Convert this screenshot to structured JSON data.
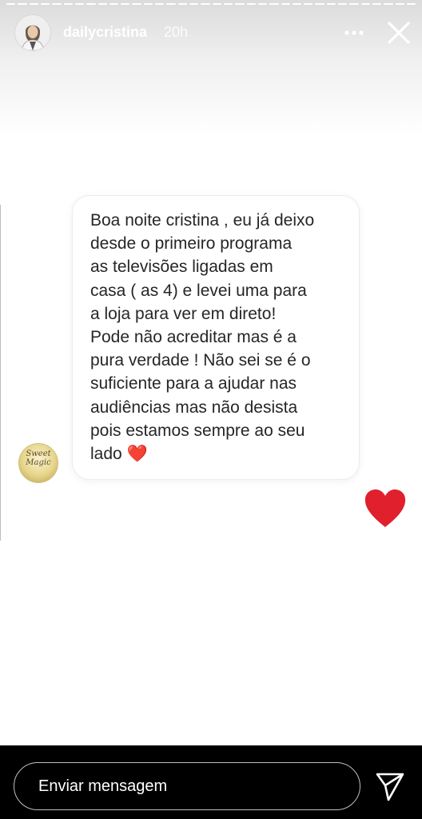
{
  "story": {
    "username": "dailycristina",
    "time_ago": "20h",
    "progress": {
      "segments": 36,
      "completed": 36
    }
  },
  "message": {
    "text": "Boa noite cristina , eu já deixo\ndesde o primeiro programa\nas televisões ligadas em\ncasa ( as 4) e levei uma para\na loja para ver em direto!\nPode não acreditar mas é a\npura verdade ! Não sei se é o\nsuficiente para a ajudar nas\naudiências mas não desista\npois estamos sempre ao seu\nlado ",
    "emoji": "❤️",
    "sender_avatar_text": "Sweet Magic"
  },
  "reply": {
    "placeholder": "Enviar mensagem"
  },
  "icons": {
    "more": "more-options-icon",
    "close": "close-icon",
    "reaction": "heart-icon",
    "send": "send-icon"
  },
  "colors": {
    "heart": "#e0202c",
    "bubble_text": "#262626",
    "bottom_bar": "#000000"
  }
}
